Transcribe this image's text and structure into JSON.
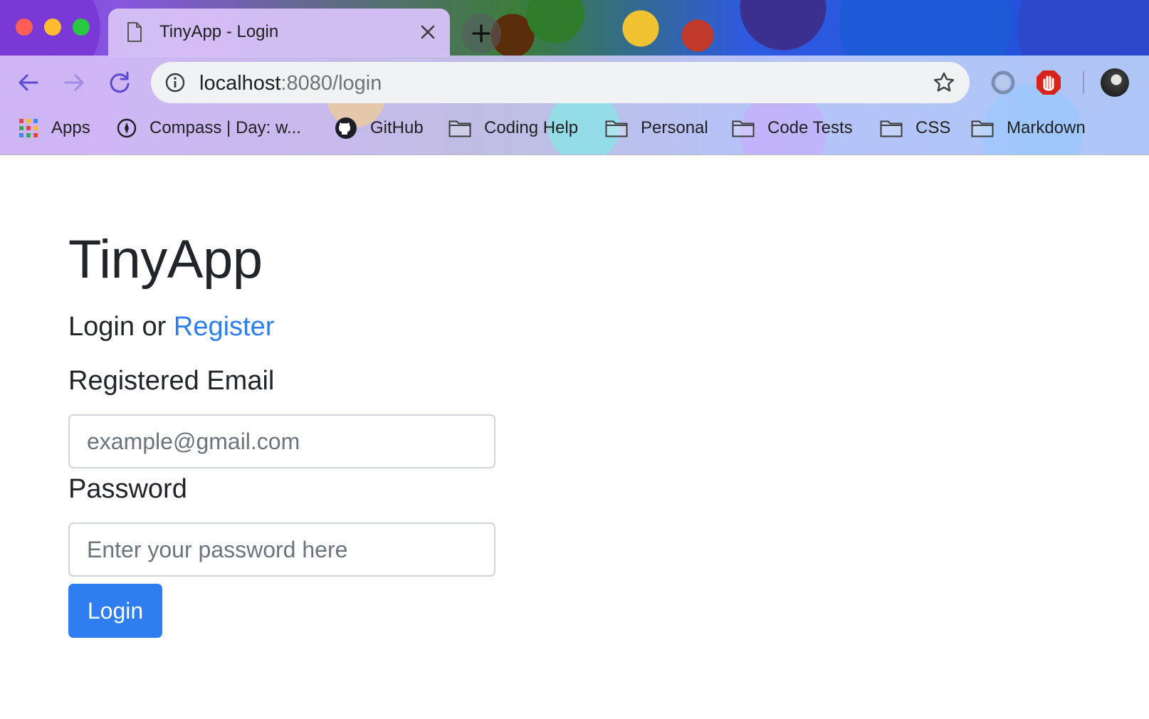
{
  "browser": {
    "tab": {
      "title": "TinyApp - Login"
    },
    "address_bar": {
      "host": "localhost",
      "path": ":8080/login"
    },
    "bookmarks": [
      {
        "label": "Apps",
        "icon": "apps-grid-icon"
      },
      {
        "label": "Compass | Day: w...",
        "icon": "compass-icon"
      },
      {
        "label": "GitHub",
        "icon": "github-icon"
      },
      {
        "label": "Coding Help",
        "icon": "folder-icon"
      },
      {
        "label": "Personal",
        "icon": "folder-icon"
      },
      {
        "label": "Code Tests",
        "icon": "folder-icon"
      },
      {
        "label": "CSS",
        "icon": "folder-icon"
      },
      {
        "label": "Markdown",
        "icon": "folder-icon"
      }
    ]
  },
  "page": {
    "title": "TinyApp",
    "subtitle_prefix": "Login or ",
    "register_link": "Register",
    "email_label": "Registered Email",
    "email_placeholder": "example@gmail.com",
    "email_value": "",
    "password_label": "Password",
    "password_placeholder": "Enter your password here",
    "password_value": "",
    "login_button": "Login"
  },
  "colors": {
    "primary": "#2f7ef0",
    "text": "#212529",
    "placeholder": "#6c757d",
    "input_border": "#ced4da"
  }
}
